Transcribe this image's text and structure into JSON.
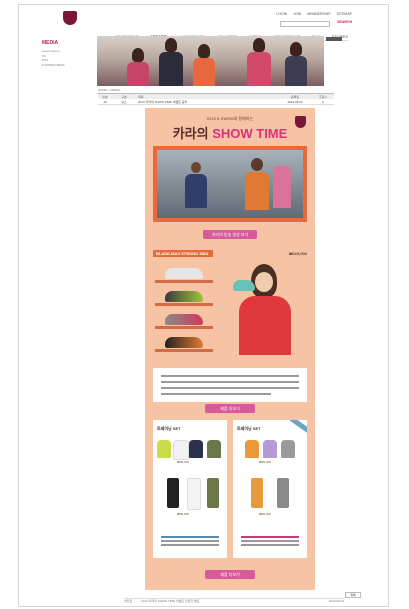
{
  "header": {
    "logo_caption": "",
    "util_links": [
      "LOGIN",
      "JOIN",
      "MEMBERSHIP",
      "SITEMAP"
    ],
    "search_label": "SEARCH"
  },
  "nav": [
    "FOOTWEAR",
    "APPAREL",
    "ACCESSORY",
    "ATHLETES",
    "MEDIA",
    "MEMBERSHIP",
    "FAQ",
    "STORES"
  ],
  "nav_active": "MEDIA",
  "sidebar": {
    "title": "MEDIA",
    "items": [
      "Lorem ipsum",
      "CF",
      "Print",
      "K-SWISS NEWS"
    ]
  },
  "breadcrumb": "HOME > MEDIA",
  "board": {
    "headers": [
      "번호",
      "구분",
      "제목",
      "등록일",
      "조회수"
    ],
    "row": [
      "16",
      "뉴스",
      "2013 카라의 SHOW TIME 이벤트 공지",
      "2013.03.04",
      "0"
    ]
  },
  "promo": {
    "subtitle": "2013 K-SWISS와 함께하는",
    "title_part1": "카라의",
    "title_part2": "SHOW TIME",
    "hero_button": "카라의 방송 영상 보기",
    "shoe_label": "BLADE-MAX STRONG SMU",
    "shoe_price": "₩119,000",
    "more_button": "제품 더보기",
    "set_left_title": "트레이닝 SET",
    "set_left_prices": [
      "₩99,000",
      "₩69,000"
    ],
    "set_right_title": "트레이닝 SET",
    "set_right_prices": [
      "₩99,000",
      "₩69,000"
    ],
    "bottom_button": "제품 더보기"
  },
  "footer": {
    "prev_label": "이전글",
    "prev_title": "2013 카라의 SHOW TIME 이벤트 당첨자 발표",
    "date": "2013.03.04",
    "list_button": "목록"
  },
  "colors": {
    "brand": "#7a1636",
    "promo_bg": "#f6c4a4",
    "accent_orange": "#e86a3a",
    "accent_pink": "#d65a9c",
    "title_pink": "#d6337a"
  }
}
